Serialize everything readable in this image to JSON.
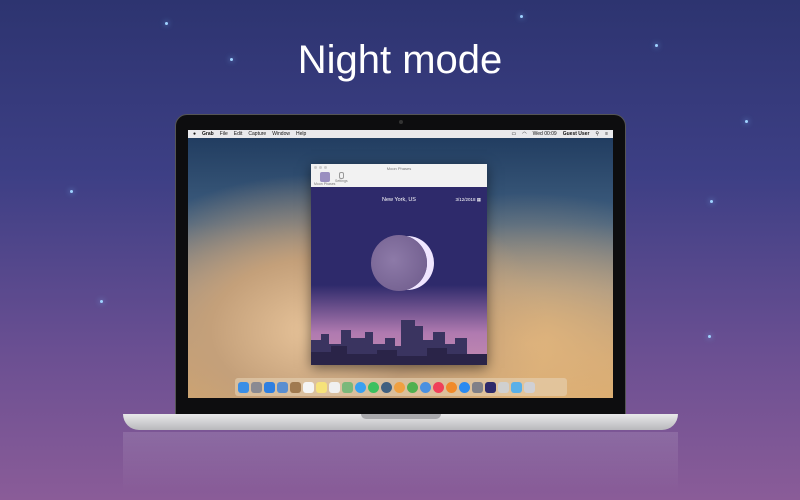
{
  "headline": "Night mode",
  "menubar": {
    "apple": "",
    "items": [
      "Grab",
      "File",
      "Edit",
      "Capture",
      "Window",
      "Help"
    ],
    "clock": "Wed 00:09",
    "user": "Guest User"
  },
  "window": {
    "title": "Moon Phases",
    "toolbar": [
      {
        "label": "Moon Phases",
        "icon": "moon-icon"
      },
      {
        "label": "Settings",
        "icon": "settings-icon"
      }
    ],
    "location": "New York, US",
    "date": "3/12/2018"
  },
  "dock": {
    "icons": [
      "finder",
      "launchpad",
      "safari",
      "mail",
      "contacts",
      "calendar",
      "notes",
      "reminders",
      "maps",
      "messages",
      "facetime",
      "photo-booth",
      "pages",
      "numbers",
      "keynote",
      "itunes",
      "ibooks",
      "app-store",
      "system-preferences",
      "moon-phases",
      "preview",
      "downloads",
      "trash"
    ],
    "colors": [
      "#3a8ee6",
      "#8a8a92",
      "#2f7fe0",
      "#5a8ed0",
      "#a07a50",
      "#f4f4f4",
      "#f6e27a",
      "#f0f0f0",
      "#7ab87a",
      "#3aa0f0",
      "#3cc060",
      "#406080",
      "#f0a040",
      "#50b050",
      "#4a90e0",
      "#f0405a",
      "#f08a2a",
      "#2a8af0",
      "#808088",
      "#2e2a6b",
      "#d0d0d0",
      "#5ab0e8",
      "#d0d0d4"
    ]
  }
}
